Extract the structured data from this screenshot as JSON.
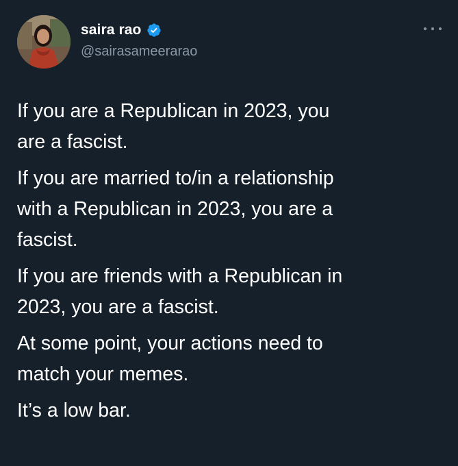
{
  "author": {
    "display_name": "saira rao",
    "handle": "@sairasameerarao",
    "verified_icon": "verified-badge-icon",
    "verified_color": "#1d9bf0"
  },
  "menu": {
    "icon": "more-options-icon"
  },
  "tweet": {
    "paragraphs": [
      "If you are a Republican in 2023, you\nare a fascist.",
      "If you are married to/in a relationship\nwith a Republican in 2023, you are a\nfascist.",
      "If you are friends with a Republican in\n2023, you are a fascist.",
      "At some point, your actions need to\nmatch your memes.",
      "It’s a low bar."
    ]
  },
  "colors": {
    "background": "#15202b",
    "text": "#ffffff",
    "secondary_text": "#8b98a5"
  }
}
